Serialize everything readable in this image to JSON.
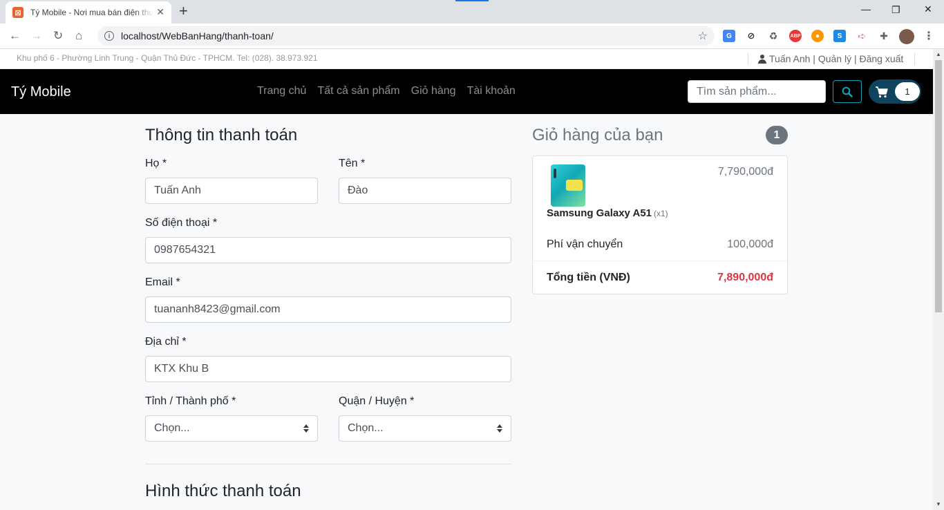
{
  "browser": {
    "tab_title": "Tý Mobile - Nơi mua bán điện thoại",
    "url": "localhost/WebBanHang/thanh-toan/",
    "new_tab": "+",
    "close": "✕"
  },
  "topbar": {
    "address": "Khu phố 6 - Phường Linh Trung - Quận Thủ Đức - TPHCM. Tel: (028). 38.973.921",
    "user_links": "Tuấn Anh | Quản lý | Đăng xuất"
  },
  "navbar": {
    "brand": "Tý Mobile",
    "menu": [
      "Trang chủ",
      "Tất cả sản phẩm",
      "Giỏ hàng",
      "Tài khoản"
    ],
    "search_placeholder": "Tìm sản phẩm...",
    "cart_count": "1"
  },
  "checkout": {
    "title": "Thông tin thanh toán",
    "last_name_label": "Họ *",
    "last_name_value": "Tuấn Anh",
    "first_name_label": "Tên *",
    "first_name_value": "Đào",
    "phone_label": "Số điện thoại *",
    "phone_value": "0987654321",
    "email_label": "Email *",
    "email_value": "tuananh8423@gmail.com",
    "address_label": "Địa chỉ *",
    "address_value": "KTX Khu B",
    "province_label": "Tỉnh / Thành phố *",
    "province_value": "Chọn...",
    "district_label": "Quận / Huyện *",
    "district_value": "Chọn...",
    "payment_title": "Hình thức thanh toán"
  },
  "cart": {
    "title": "Giỏ hàng của bạn",
    "badge": "1",
    "item_name": "Samsung Galaxy A51",
    "item_qty": "(x1)",
    "item_price": "7,790,000đ",
    "shipping_label": "Phí vận chuyển",
    "shipping_value": "100,000đ",
    "total_label": "Tổng tiền (VNĐ)",
    "total_value": "7,890,000đ"
  },
  "colors": {
    "navbar_bg": "#000000",
    "cart_pill": "#10435e",
    "search_btn": "#17a2b8",
    "total_red": "#dc3545"
  }
}
